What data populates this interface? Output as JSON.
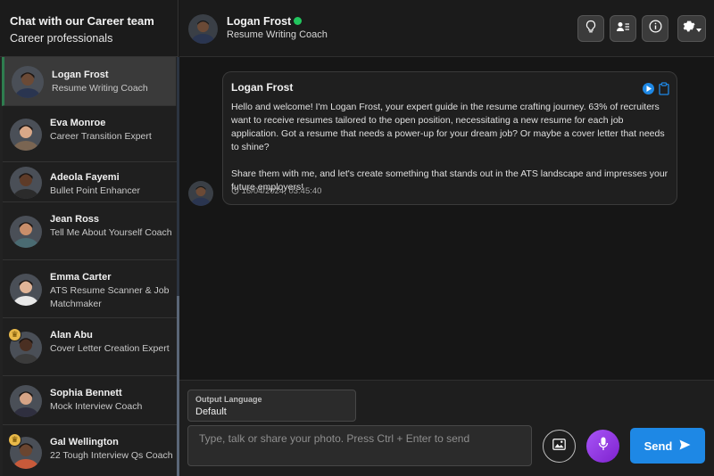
{
  "sidebar": {
    "title": "Chat with our Career team",
    "subtitle": "Career professionals",
    "coaches": [
      {
        "name": "Logan Frost",
        "role": "Resume Writing Coach",
        "premium": false,
        "active": true,
        "skin": "#6b4a36",
        "shirt": "#2a3550"
      },
      {
        "name": "Eva Monroe",
        "role": "Career Transition Expert",
        "premium": false,
        "active": false,
        "skin": "#d9a888",
        "shirt": "#7a6552"
      },
      {
        "name": "Adeola Fayemi",
        "role": "Bullet Point Enhancer",
        "premium": false,
        "active": false,
        "skin": "#5e3b28",
        "shirt": "#2b2b2b"
      },
      {
        "name": "Jean Ross",
        "role": "Tell Me About Yourself Coach",
        "premium": false,
        "active": false,
        "skin": "#c98e6a",
        "shirt": "#4a6b72"
      },
      {
        "name": "Emma Carter",
        "role": "ATS Resume Scanner & Job Matchmaker",
        "premium": false,
        "active": false,
        "skin": "#e0b497",
        "shirt": "#e8e8e8"
      },
      {
        "name": "Alan Abu",
        "role": "Cover Letter Creation Expert",
        "premium": true,
        "active": false,
        "skin": "#4a2f22",
        "shirt": "#3b3b3b"
      },
      {
        "name": "Sophia Bennett",
        "role": "Mock Interview Coach",
        "premium": false,
        "active": false,
        "skin": "#d6a486",
        "shirt": "#2f2f3f"
      },
      {
        "name": "Gal Wellington",
        "role": "22 Tough Interview Qs Coach",
        "premium": true,
        "active": false,
        "skin": "#6a4530",
        "shirt": "#c85a3a"
      }
    ]
  },
  "header": {
    "name": "Logan Frost",
    "role": "Resume Writing Coach",
    "status_color": "#22c55e",
    "buttons": [
      "lightbulb-icon",
      "contact-card-icon",
      "info-icon",
      "gear-icon"
    ]
  },
  "message": {
    "sender": "Logan Frost",
    "paragraphs": [
      "Hello and welcome! I'm Logan Frost, your expert guide in the resume crafting journey. 63% of recruiters want to receive resumes tailored to the open position, necessitating a new resume for each job application. Got a resume that needs a power-up for your dream job? Or maybe a cover letter that needs to shine?",
      "Share them with me, and let's create something that stands out in the ATS landscape and impresses your future employers!"
    ],
    "timestamp": "16/04/2024, 03:45:40"
  },
  "composer": {
    "language_label": "Output Language",
    "language_value": "Default",
    "placeholder": "Type, talk or share your photo. Press Ctrl + Enter to send",
    "send_label": "Send"
  },
  "colors": {
    "accent": "#1e88e5",
    "mic": "#9333ea",
    "active_marker": "#2e7d4f"
  }
}
